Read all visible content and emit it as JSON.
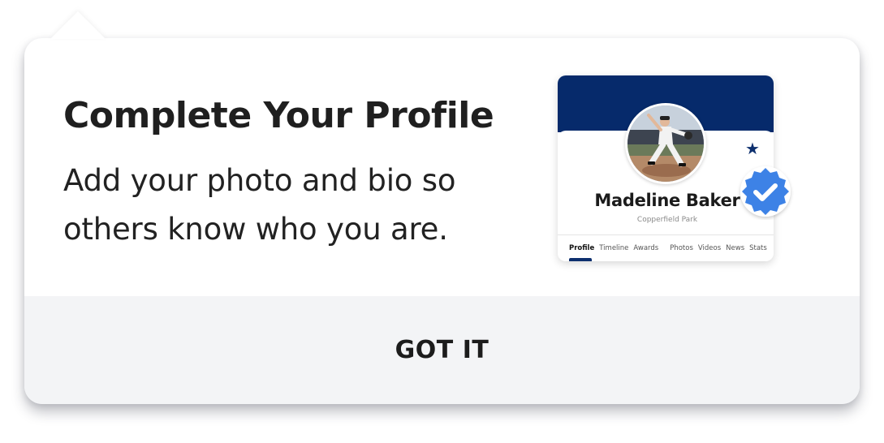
{
  "coachmark": {
    "title": "Complete Your Profile",
    "subtitle": "Add your photo and bio so others know who you are.",
    "dismiss_label": "GOT IT"
  },
  "preview": {
    "name": "Madeline Baker",
    "location": "Copperfield Park",
    "tabs": [
      "Profile",
      "Timeline",
      "Awards",
      "Photos",
      "Videos",
      "News",
      "Stats"
    ],
    "active_tab": "Profile",
    "icons": [
      "avatar-photo",
      "star-icon",
      "verified-badge-icon"
    ]
  },
  "colors": {
    "banner": "#062a6b",
    "accent_navy": "#0d2f6e",
    "verified_blue": "#3c82e6",
    "footer_bg": "#f3f4f6"
  }
}
